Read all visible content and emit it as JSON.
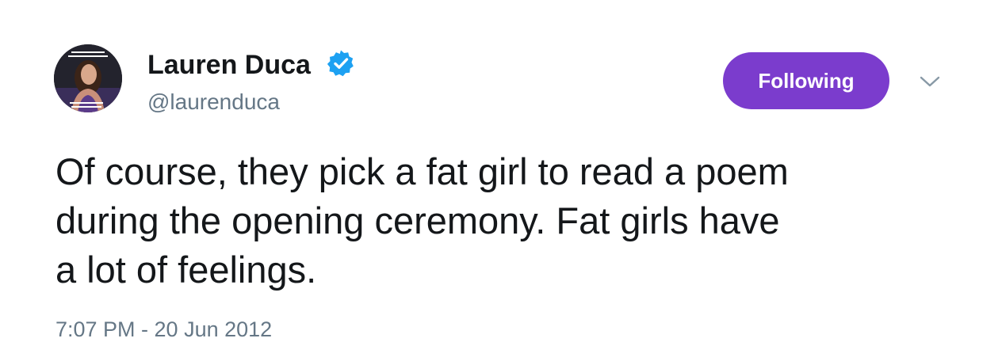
{
  "author": {
    "display_name": "Lauren Duca",
    "handle": "@laurenduca",
    "verified": true,
    "avatar_caption_top": "WANTS TO BE TAKEN SERIOUSLY",
    "avatar_caption_bottom": "ACTS LIKE A 13 YEAR OLD GIRL"
  },
  "actions": {
    "follow_label": "Following",
    "more_icon": "chevron-down-icon"
  },
  "tweet": {
    "text": "Of course, they pick a fat girl to read a poem\nduring the opening ceremony. Fat girls have\na lot of feelings.",
    "timestamp": "7:07 PM - 20 Jun 2012"
  },
  "colors": {
    "follow_button": "#7b3ccd",
    "verified_badge": "#1da1f2",
    "secondary_text": "#657786",
    "primary_text": "#14171a"
  }
}
